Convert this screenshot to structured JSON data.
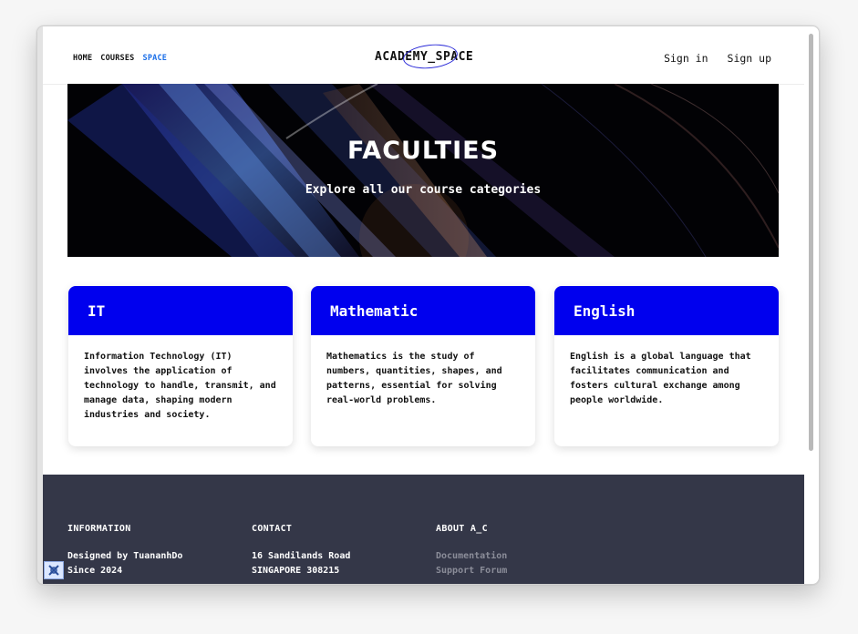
{
  "nav": {
    "links": [
      "HOME",
      "COURSES",
      "SPACE"
    ],
    "active": "SPACE",
    "logo": "ACADEMY_SPACE",
    "sign_in": "Sign in",
    "sign_up": "Sign up"
  },
  "hero": {
    "title": "FACULTIES",
    "subtitle": "Explore all our course categories"
  },
  "faculties": [
    {
      "name": "IT",
      "description": "Information Technology (IT) involves the application of technology to handle, transmit, and manage data, shaping modern industries and society."
    },
    {
      "name": "Mathematic",
      "description": "Mathematics is the study of numbers, quantities, shapes, and patterns, essential for solving real-world problems."
    },
    {
      "name": "English",
      "description": "English is a global language that facilitates communication and fosters cultural exchange among people worldwide."
    }
  ],
  "footer": {
    "information": {
      "title": "INFORMATION",
      "lines": [
        "Designed by TuananhDo",
        "Since 2024"
      ]
    },
    "contact": {
      "title": "CONTACT",
      "lines": [
        "16 Sandilands Road",
        "SINGAPORE 308215"
      ]
    },
    "about": {
      "title": "ABOUT A_C",
      "links": [
        "Documentation",
        "Support Forum"
      ]
    }
  },
  "colors": {
    "accent": "#0000ee",
    "active_link": "#1a6ee8",
    "footer_bg": "#343748",
    "footer_muted": "#8b8d99"
  },
  "icons": {
    "bottom_left": "sprocket-icon",
    "logo_ring": "ellipse-outline"
  }
}
